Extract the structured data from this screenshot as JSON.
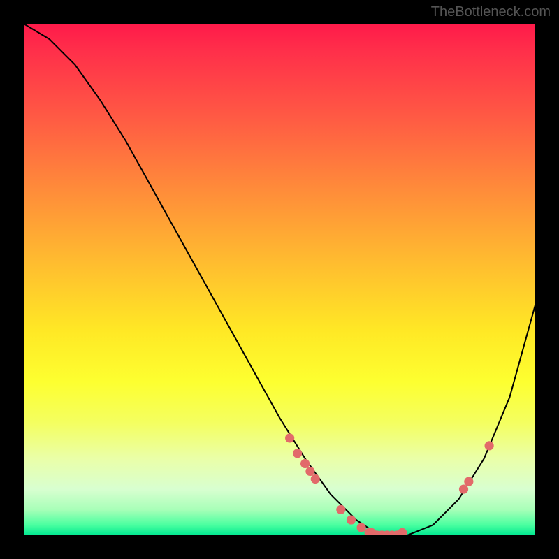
{
  "watermark": "TheBottleneck.com",
  "chart_data": {
    "type": "line",
    "title": "",
    "xlabel": "",
    "ylabel": "",
    "xlim": [
      0,
      100
    ],
    "ylim": [
      0,
      100
    ],
    "series": [
      {
        "name": "curve",
        "x": [
          0,
          5,
          10,
          15,
          20,
          25,
          30,
          35,
          40,
          45,
          50,
          55,
          60,
          65,
          68,
          70,
          72,
          75,
          80,
          85,
          90,
          95,
          100
        ],
        "y": [
          100,
          97,
          92,
          85,
          77,
          68,
          59,
          50,
          41,
          32,
          23,
          15,
          8,
          3,
          1,
          0,
          0,
          0,
          2,
          7,
          15,
          27,
          45
        ]
      }
    ],
    "markers": [
      {
        "x": 52,
        "y": 19
      },
      {
        "x": 53.5,
        "y": 16
      },
      {
        "x": 55,
        "y": 14
      },
      {
        "x": 56,
        "y": 12.5
      },
      {
        "x": 57,
        "y": 11
      },
      {
        "x": 62,
        "y": 5
      },
      {
        "x": 64,
        "y": 3
      },
      {
        "x": 66,
        "y": 1.5
      },
      {
        "x": 67.5,
        "y": 0.5
      },
      {
        "x": 68,
        "y": 0.5
      },
      {
        "x": 69,
        "y": 0
      },
      {
        "x": 70,
        "y": 0
      },
      {
        "x": 71,
        "y": 0
      },
      {
        "x": 72,
        "y": 0
      },
      {
        "x": 73,
        "y": 0
      },
      {
        "x": 74,
        "y": 0.5
      },
      {
        "x": 86,
        "y": 9
      },
      {
        "x": 87,
        "y": 10.5
      },
      {
        "x": 91,
        "y": 17.5
      }
    ],
    "gradient_stops": [
      {
        "pos": 0,
        "color": "#ff1a4a"
      },
      {
        "pos": 60,
        "color": "#ffe825"
      },
      {
        "pos": 100,
        "color": "#00e890"
      }
    ]
  }
}
